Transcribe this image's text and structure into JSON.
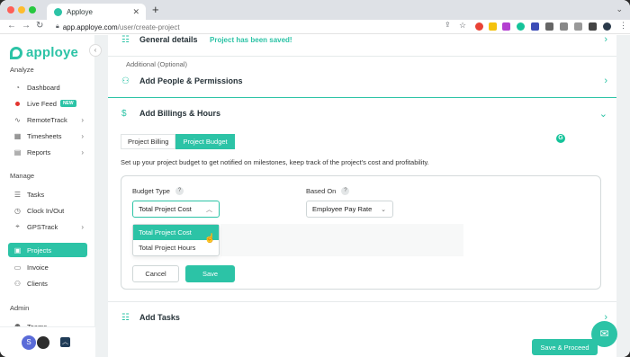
{
  "browser": {
    "tab_title": "Apploye",
    "url_host": "app.apploye.com",
    "url_path": "/user/create-project"
  },
  "sidebar": {
    "logo_text": "apploye",
    "sections": {
      "analyze": "Analyze",
      "manage": "Manage",
      "admin": "Admin"
    },
    "items": [
      {
        "label": "Dashboard",
        "icon": "dashboard-icon"
      },
      {
        "label": "Live Feed",
        "icon": "live-dot-icon",
        "badge": "NEW"
      },
      {
        "label": "RemoteTrack",
        "icon": "activity-icon",
        "has_children": true
      },
      {
        "label": "Timesheets",
        "icon": "calendar-icon",
        "has_children": true
      },
      {
        "label": "Reports",
        "icon": "reports-icon",
        "has_children": true
      },
      {
        "label": "Tasks",
        "icon": "tasks-icon"
      },
      {
        "label": "Clock In/Out",
        "icon": "clock-icon"
      },
      {
        "label": "GPSTrack",
        "icon": "map-pin-icon",
        "has_children": true
      },
      {
        "label": "Projects",
        "icon": "projects-icon",
        "active": true
      },
      {
        "label": "Invoice",
        "icon": "invoice-icon"
      },
      {
        "label": "Clients",
        "icon": "clients-icon"
      },
      {
        "label": "Teams",
        "icon": "teams-icon"
      }
    ],
    "user_initial": "S"
  },
  "main": {
    "general_details": "General details",
    "saved_message": "Project has been saved!",
    "additional_label": "Additional (Optional)",
    "people_permissions": "Add People & Permissions",
    "billings_hours": "Add Billings & Hours",
    "tabs": [
      {
        "label": "Project Billing",
        "selected": false
      },
      {
        "label": "Project Budget",
        "selected": true
      }
    ],
    "budget_description": "Set up your project budget to get notified on milestones, keep track of the project's cost and profitability.",
    "budget_type_label": "Budget Type",
    "budget_type_value": "Total Project Cost",
    "budget_type_options": [
      "Total Project Cost",
      "Total Project Hours"
    ],
    "based_on_label": "Based On",
    "based_on_value": "Employee Pay Rate",
    "cancel_label": "Cancel",
    "save_label": "Save",
    "add_tasks": "Add Tasks",
    "save_proceed_label": "Save & Proceed"
  },
  "colors": {
    "accent": "#2cc3a6",
    "live_dot": "#e3342f"
  }
}
